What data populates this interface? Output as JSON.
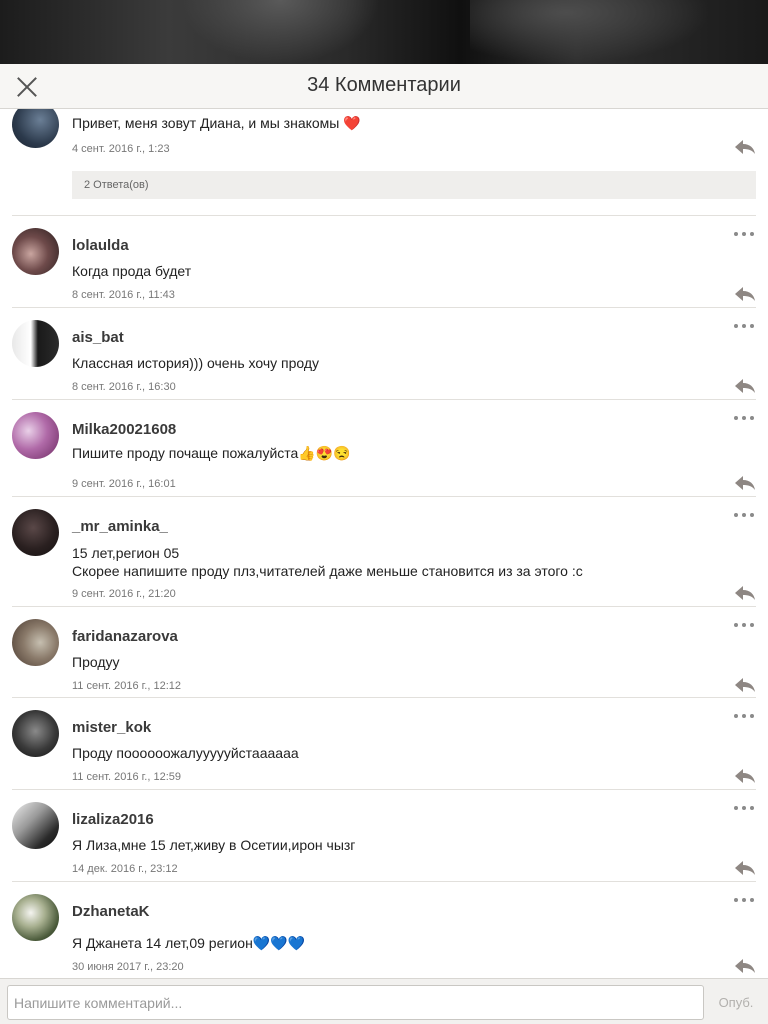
{
  "header": {
    "title": "34 Комментарии"
  },
  "comments": [
    {
      "username": "",
      "lines": [
        "Привет, меня зовут Диана, и мы знакомы ❤️"
      ],
      "date": "4 сент. 2016 г., 1:23",
      "replies_label": "2 Ответа(ов)"
    },
    {
      "username": "lolaulda",
      "lines": [
        "Когда прода будет"
      ],
      "date": "8 сент. 2016 г., 11:43"
    },
    {
      "username": "ais_bat",
      "lines": [
        "Классная история))) очень хочу проду"
      ],
      "date": "8 сент. 2016 г., 16:30"
    },
    {
      "username": "Milka20021608",
      "lines": [
        "Пишите проду почаще пожалуйста👍😍😒"
      ],
      "date": "9 сент. 2016 г., 16:01"
    },
    {
      "username": "_mr_aminka_",
      "lines": [
        "15 лет,регион 05",
        "Скорее напишите проду плз,читателей даже меньше становится из за этого :с"
      ],
      "date": "9 сент. 2016 г., 21:20"
    },
    {
      "username": "faridanazarova",
      "lines": [
        "Продуу"
      ],
      "date": "11 сент. 2016 г., 12:12"
    },
    {
      "username": "mister_kok",
      "lines": [
        "Проду поооооожалуууууйстаааааа"
      ],
      "date": "11 сент. 2016 г., 12:59"
    },
    {
      "username": "lizaliza2016",
      "lines": [
        "Я Лиза,мне 15 лет,живу в Осетии,ирон чызг"
      ],
      "date": "14 дек. 2016 г., 23:12"
    },
    {
      "username": "DzhanetaK",
      "lines": [
        "Я Джанета 14 лет,09 регион💙💙💙"
      ],
      "date": "30 июня 2017 г., 23:20"
    }
  ],
  "footer": {
    "placeholder": "Напишите комментарий...",
    "publish_label": "Опуб."
  },
  "icons": {
    "close": "close-icon",
    "more": "more-dots-icon",
    "reply": "reply-arrow-icon"
  },
  "colors": {
    "header_bg": "#f7f6f4",
    "icon_gray": "#8a8a8a",
    "reply_arrow": "#8e8783"
  }
}
